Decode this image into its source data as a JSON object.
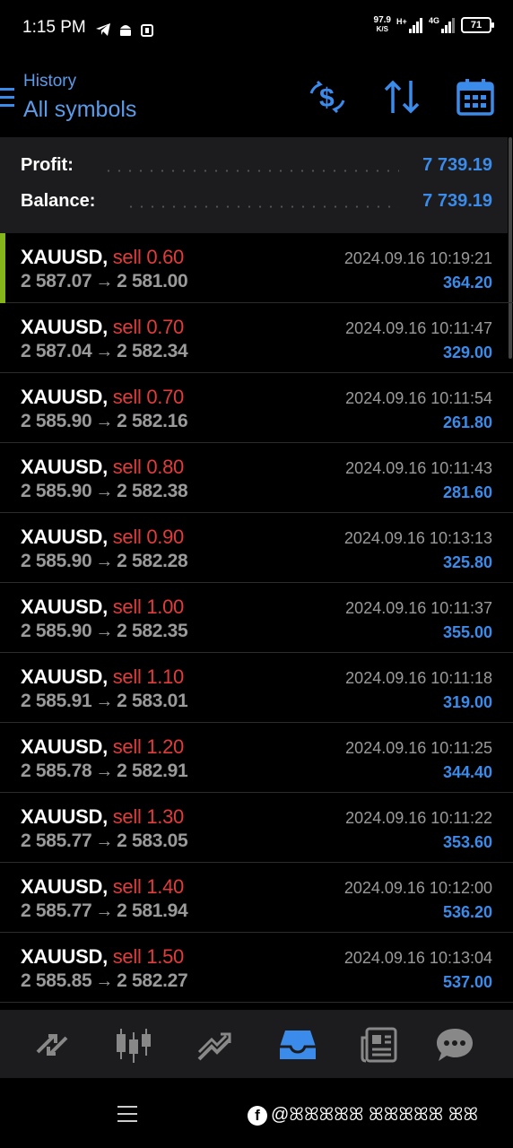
{
  "status_bar": {
    "time": "1:15 PM",
    "net_speed_value": "97.9",
    "net_speed_unit": "K/S",
    "network": "4G",
    "battery": "71"
  },
  "header": {
    "title": "History",
    "subtitle": "All symbols"
  },
  "summary": {
    "profit_label": "Profit:",
    "profit_value": "7 739.19",
    "balance_label": "Balance:",
    "balance_value": "7 739.19"
  },
  "trades": [
    {
      "symbol": "XAUUSD,",
      "type": "sell 0.60",
      "date": "2024.09.16 10:19:21",
      "open": "2 587.07",
      "close": "2 581.00",
      "profit": "364.20"
    },
    {
      "symbol": "XAUUSD,",
      "type": "sell 0.70",
      "date": "2024.09.16 10:11:47",
      "open": "2 587.04",
      "close": "2 582.34",
      "profit": "329.00"
    },
    {
      "symbol": "XAUUSD,",
      "type": "sell 0.70",
      "date": "2024.09.16 10:11:54",
      "open": "2 585.90",
      "close": "2 582.16",
      "profit": "261.80"
    },
    {
      "symbol": "XAUUSD,",
      "type": "sell 0.80",
      "date": "2024.09.16 10:11:43",
      "open": "2 585.90",
      "close": "2 582.38",
      "profit": "281.60"
    },
    {
      "symbol": "XAUUSD,",
      "type": "sell 0.90",
      "date": "2024.09.16 10:13:13",
      "open": "2 585.90",
      "close": "2 582.28",
      "profit": "325.80"
    },
    {
      "symbol": "XAUUSD,",
      "type": "sell 1.00",
      "date": "2024.09.16 10:11:37",
      "open": "2 585.90",
      "close": "2 582.35",
      "profit": "355.00"
    },
    {
      "symbol": "XAUUSD,",
      "type": "sell 1.10",
      "date": "2024.09.16 10:11:18",
      "open": "2 585.91",
      "close": "2 583.01",
      "profit": "319.00"
    },
    {
      "symbol": "XAUUSD,",
      "type": "sell 1.20",
      "date": "2024.09.16 10:11:25",
      "open": "2 585.78",
      "close": "2 582.91",
      "profit": "344.40"
    },
    {
      "symbol": "XAUUSD,",
      "type": "sell 1.30",
      "date": "2024.09.16 10:11:22",
      "open": "2 585.77",
      "close": "2 583.05",
      "profit": "353.60"
    },
    {
      "symbol": "XAUUSD,",
      "type": "sell 1.40",
      "date": "2024.09.16 10:12:00",
      "open": "2 585.77",
      "close": "2 581.94",
      "profit": "536.20"
    },
    {
      "symbol": "XAUUSD,",
      "type": "sell 1.50",
      "date": "2024.09.16 10:13:04",
      "open": "2 585.85",
      "close": "2 582.27",
      "profit": "537.00"
    }
  ],
  "trade_arrow": "→",
  "bottom_nav": [
    {
      "icon": "quotes-icon"
    },
    {
      "icon": "chart-icon"
    },
    {
      "icon": "trade-icon"
    },
    {
      "icon": "history-icon",
      "active": true
    },
    {
      "icon": "news-icon"
    },
    {
      "icon": "chat-icon"
    }
  ],
  "watermark": {
    "text": "@ꕤꕤꕤꕤꕤ ꕤꕤꕤꕤꕤ ꕤꕤ"
  },
  "colors": {
    "accent": "#3b8bea",
    "sell": "#e23b3b",
    "active_bar": "#84b51a",
    "muted": "#9a9a9a"
  }
}
